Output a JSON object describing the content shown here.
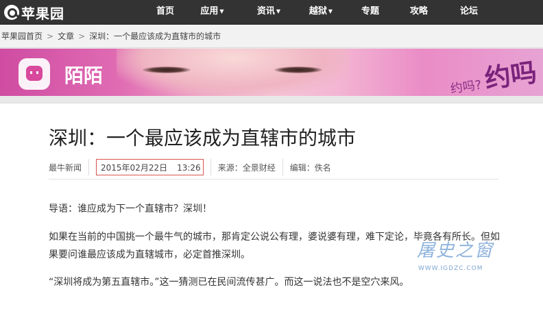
{
  "header": {
    "logo_text": "苹果园",
    "nav": [
      {
        "label": "首页",
        "has_dropdown": false
      },
      {
        "label": "应用",
        "has_dropdown": true
      },
      {
        "label": "资讯",
        "has_dropdown": true
      },
      {
        "label": "越狱",
        "has_dropdown": true
      },
      {
        "label": "专题",
        "has_dropdown": false
      },
      {
        "label": "攻略",
        "has_dropdown": false
      },
      {
        "label": "论坛",
        "has_dropdown": false
      }
    ]
  },
  "breadcrumb": {
    "items": [
      "苹果园首页",
      "文章",
      "深圳：一个最应该成为直辖市的城市"
    ],
    "separator": ">"
  },
  "banner": {
    "brand_name": "陌陌",
    "callout_small": "约吗?",
    "callout_big": "约吗"
  },
  "article": {
    "title": "深圳：一个最应该成为直辖市的城市",
    "source_site": "最牛新闻",
    "date": "2015年02月22日",
    "time": "13:26",
    "source": "来源：全景财经",
    "editor": "编辑：佚名",
    "paragraphs": [
      "导语：谁应成为下一个直辖市？深圳！",
      "如果在当前的中国挑一个最牛气的城市，那肯定公说公有理，婆说婆有理，难下定论，毕竟各有所长。但如果要问谁最应该成为直辖城市，必定首推深圳。",
      "“深圳将成为第五直辖市。”这一猜测已在民间流传甚广。而这一说法也不是空穴来风。"
    ]
  },
  "watermark": {
    "script_text": "屠史之窗",
    "url": "WWW.IGDZC.COM"
  },
  "colors": {
    "topbar": "#333333",
    "date_highlight": "#d9534f",
    "banner_pink": "#e06cb3"
  }
}
